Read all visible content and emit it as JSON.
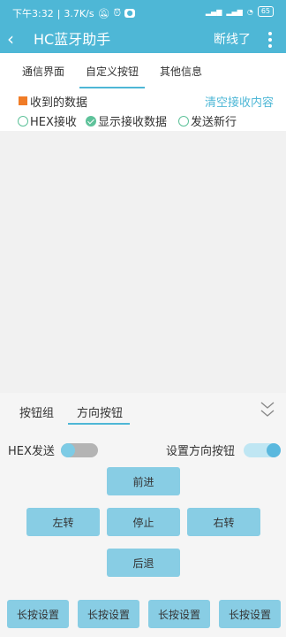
{
  "status_bar": {
    "time": "下午3:32",
    "net_speed": "3.7K/s",
    "battery": "65"
  },
  "app_bar": {
    "title": "HC蓝牙助手",
    "disconnect_label": "断线了"
  },
  "tabs": [
    {
      "label": "通信界面"
    },
    {
      "label": "自定义按钮"
    },
    {
      "label": "其他信息"
    }
  ],
  "receive": {
    "title": "收到的数据",
    "clear_label": "清空接收内容"
  },
  "options": [
    {
      "label": "HEX接收",
      "checked": false
    },
    {
      "label": "显示接收数据",
      "checked": true
    },
    {
      "label": "发送新行",
      "checked": false
    }
  ],
  "bottom_tabs": [
    {
      "label": "按钮组"
    },
    {
      "label": "方向按钮"
    }
  ],
  "toggles": {
    "hex_send_label": "HEX发送",
    "hex_send_on": false,
    "set_direction_label": "设置方向按钮",
    "set_direction_on": true
  },
  "direction_buttons": {
    "forward": "前进",
    "left": "左转",
    "stop": "停止",
    "right": "右转",
    "back": "后退"
  },
  "long_press_buttons": [
    "长按设置",
    "长按设置",
    "长按设置",
    "长按设置"
  ],
  "colors": {
    "accent": "#4eb7d6",
    "button": "#88cde4",
    "orange": "#f07c27",
    "green": "#5ec29a"
  }
}
